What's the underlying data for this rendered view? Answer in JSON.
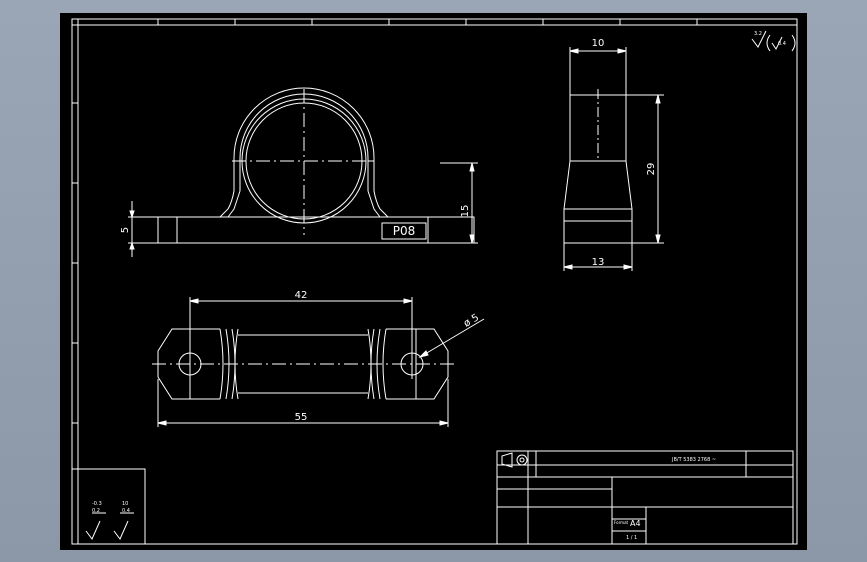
{
  "colors": {
    "background_outer": "#97a3b3",
    "sheet": "#000000",
    "lines": "#ffffff"
  },
  "front_view": {
    "label_part": "P08",
    "dim_height_total": "15",
    "dim_base_thickness": "5"
  },
  "side_view": {
    "dim_top_width": "10",
    "dim_height": "29",
    "dim_base_width": "13"
  },
  "top_view": {
    "dim_hole_spacing": "42",
    "dim_overall_length": "55",
    "dim_hole_diameter": "ø 5"
  },
  "roughness": {
    "top_right_value": "3.2",
    "top_right_paren_value": "0.4",
    "left_value_1": "-0.3",
    "left_value_2": "0.2",
    "left_value_3": "10",
    "left_value_4": "0.4"
  },
  "title_block": {
    "standard_text": "JB/T 5383  2768 ~",
    "format_label": "Format",
    "format_value": "A4",
    "scale_text": "1 / 1"
  }
}
